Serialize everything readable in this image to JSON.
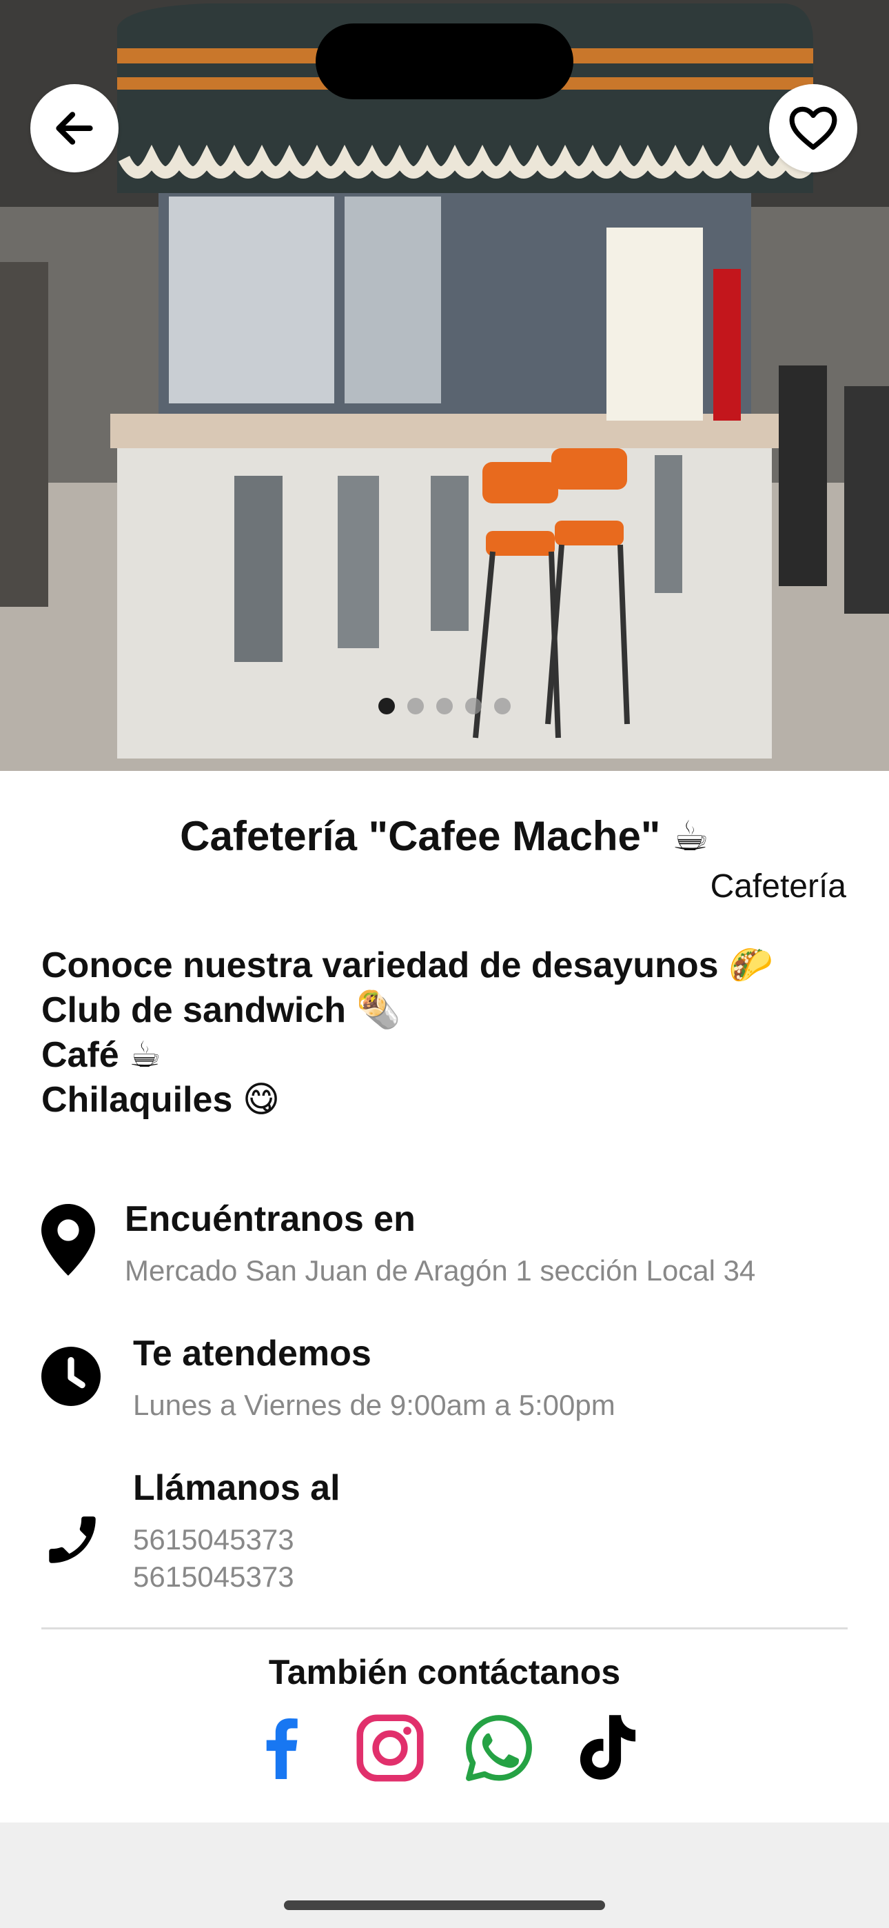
{
  "header": {
    "back_icon": "arrow-left-icon",
    "favorite_icon": "heart-outline-icon"
  },
  "carousel": {
    "dot_count": 5,
    "active_index": 0
  },
  "business": {
    "name": "Cafetería \"Cafee Mache\" ☕",
    "category": "Cafetería",
    "description_lines": [
      "Conoce nuestra variedad de desayunos 🌮",
      "Club de sandwich 🌯",
      "Café ☕",
      "Chilaquiles 😋"
    ]
  },
  "location": {
    "title": "Encuéntranos en",
    "value": "Mercado San Juan de Aragón 1 sección Local 34",
    "icon": "map-pin-icon"
  },
  "hours": {
    "title": "Te atendemos",
    "value": "Lunes a Viernes de 9:00am a 5:00pm",
    "icon": "clock-icon"
  },
  "phone": {
    "title": "Llámanos al",
    "numbers": [
      "5615045373",
      "5615045373"
    ],
    "icon": "phone-icon"
  },
  "contact": {
    "title": "También contáctanos",
    "socials": [
      "facebook-icon",
      "instagram-icon",
      "whatsapp-icon",
      "tiktok-icon"
    ]
  },
  "colors": {
    "facebook": "#1877F2",
    "instagram": "#E1306C",
    "whatsapp": "#25A244",
    "text_primary": "#111111",
    "text_secondary": "#888888"
  }
}
